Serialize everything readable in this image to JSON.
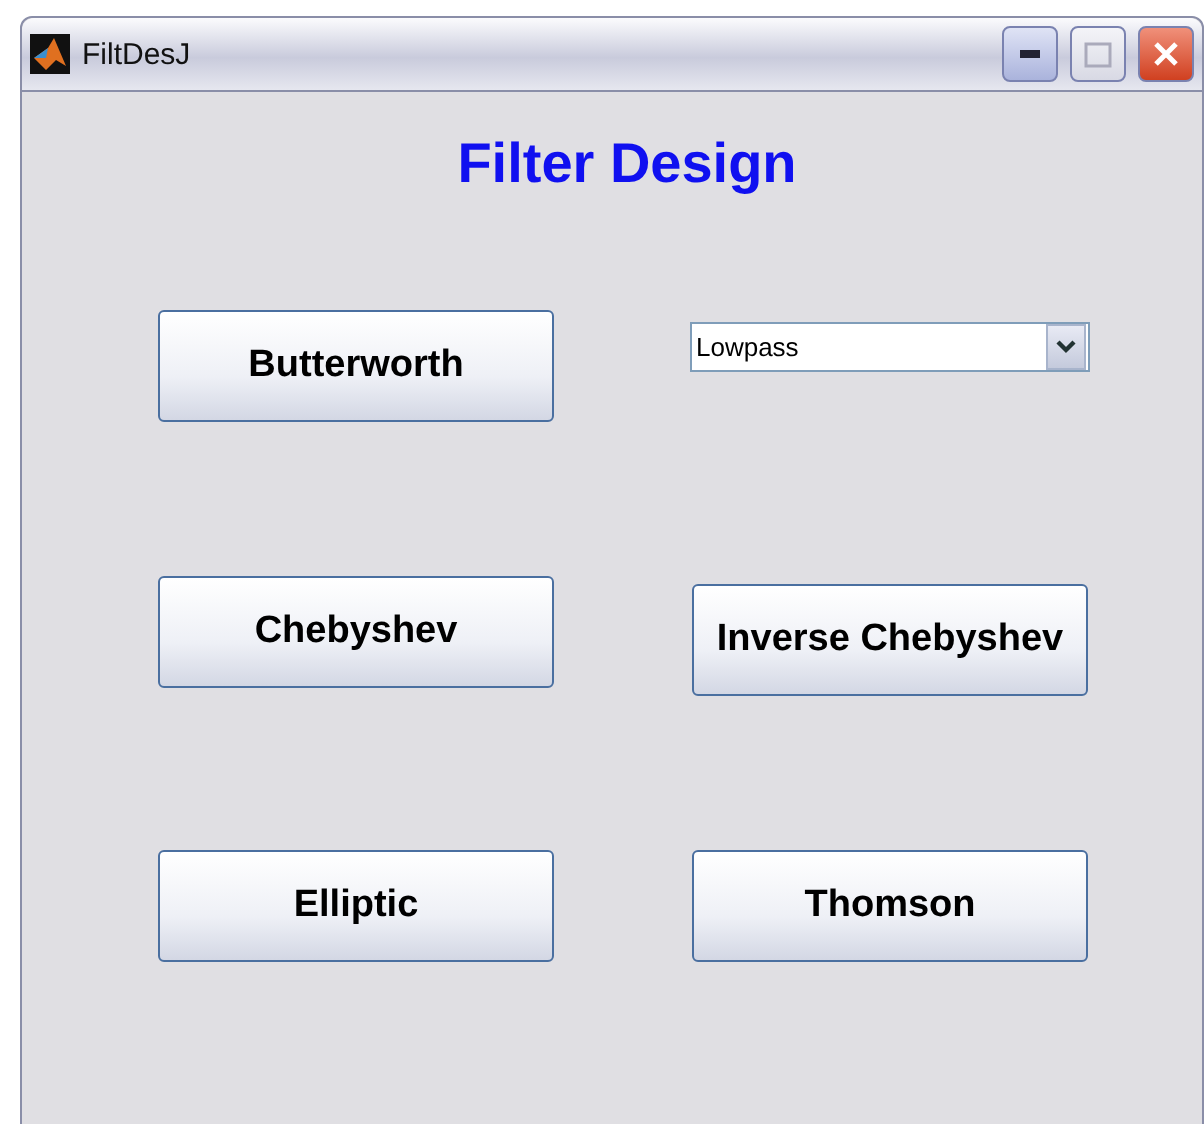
{
  "window": {
    "title": "FiltDesJ"
  },
  "heading": "Filter Design",
  "filter_type": {
    "value": "Lowpass"
  },
  "left_buttons": [
    "Butterworth",
    "Chebyshev",
    "Elliptic"
  ],
  "right_buttons": [
    "Inverse Chebyshev",
    "Thomson"
  ]
}
